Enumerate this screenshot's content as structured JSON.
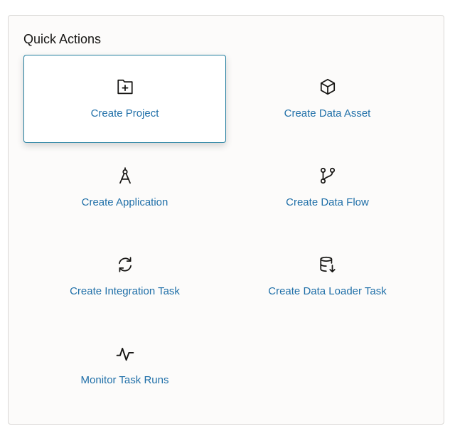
{
  "panel": {
    "title": "Quick Actions"
  },
  "actions": [
    {
      "label": "Create Project",
      "icon": "folder-plus-icon",
      "selected": true
    },
    {
      "label": "Create Data Asset",
      "icon": "cube-icon",
      "selected": false
    },
    {
      "label": "Create Application",
      "icon": "compass-icon",
      "selected": false
    },
    {
      "label": "Create Data Flow",
      "icon": "flow-branch-icon",
      "selected": false
    },
    {
      "label": "Create Integration Task",
      "icon": "refresh-icon",
      "selected": false
    },
    {
      "label": "Create Data Loader Task",
      "icon": "database-download-icon",
      "selected": false
    },
    {
      "label": "Monitor Task Runs",
      "icon": "activity-pulse-icon",
      "selected": false
    }
  ],
  "colors": {
    "link": "#1f6fa8",
    "selected_border": "#227e9e",
    "icon": "#161513"
  }
}
